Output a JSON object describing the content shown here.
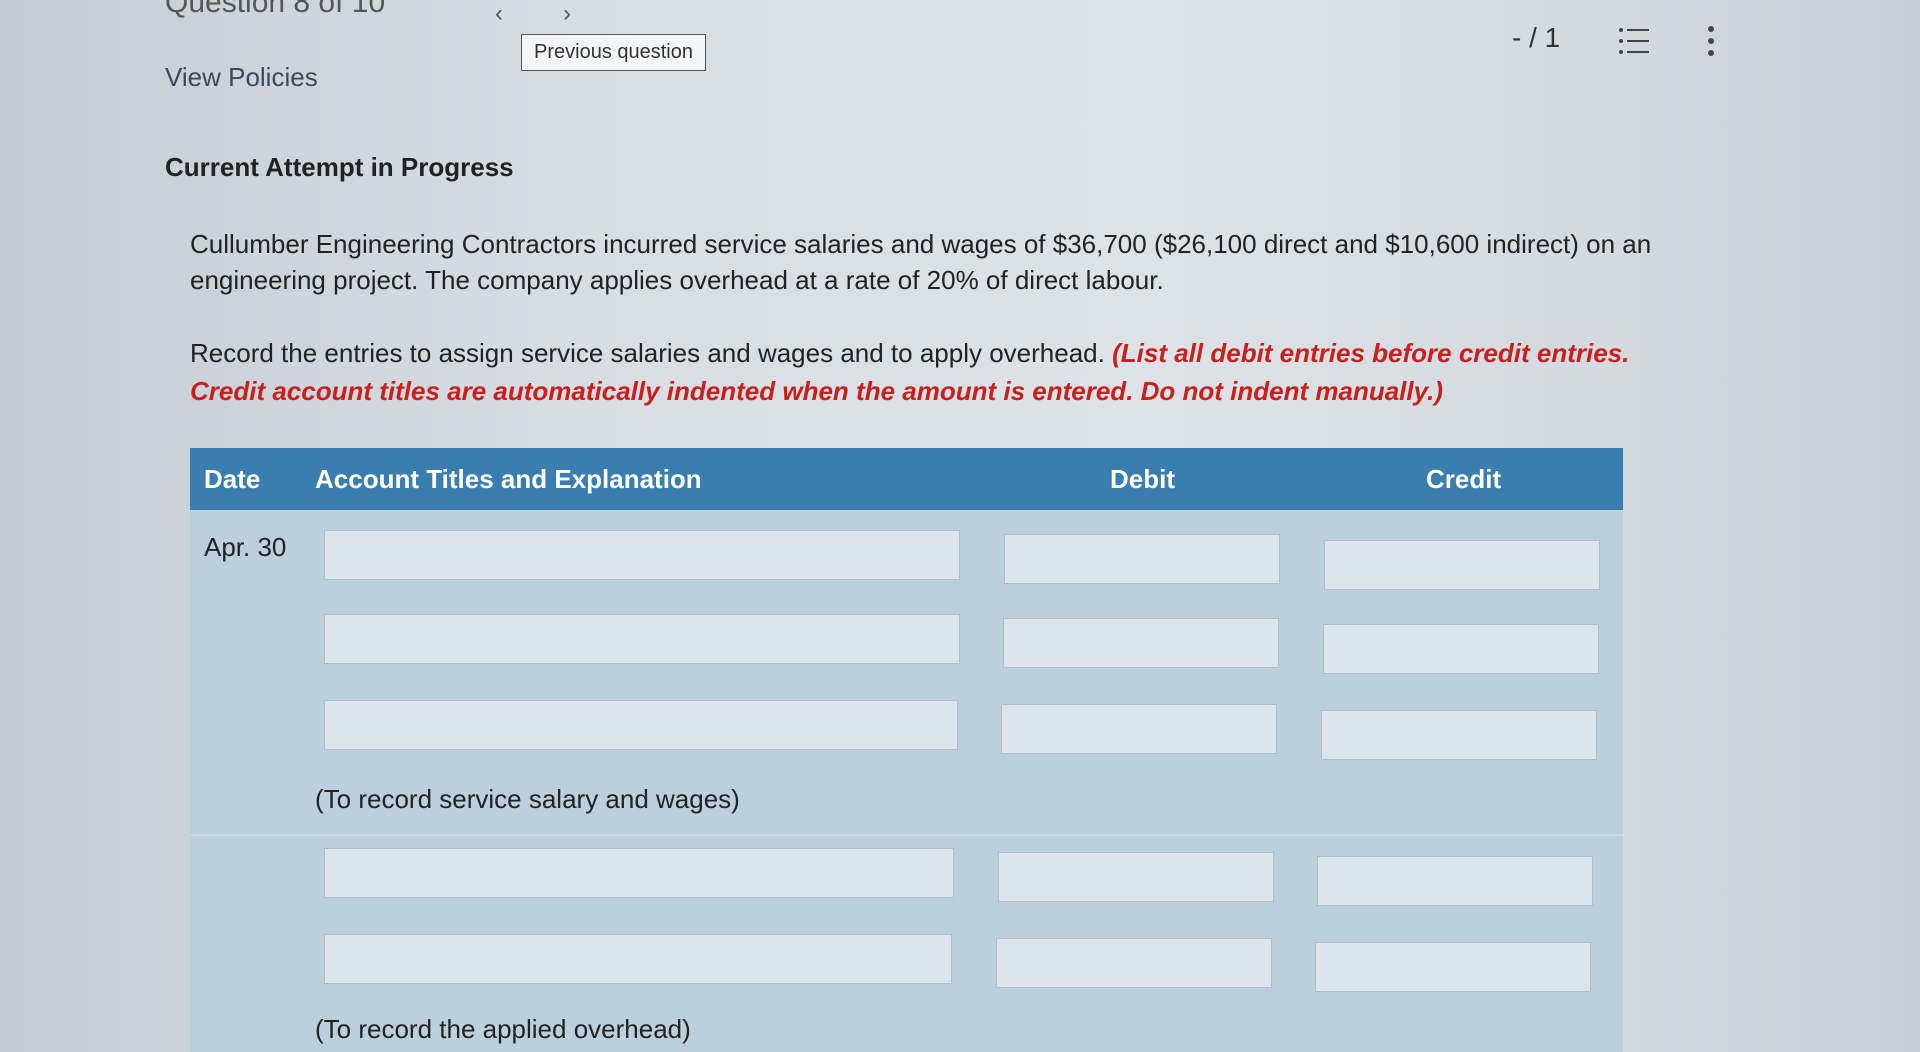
{
  "header": {
    "question_counter": "Question 8 of 10",
    "view_policies": "View Policies",
    "tooltip": "Previous question",
    "score": "- / 1",
    "prev_arrow": "‹",
    "next_arrow": "›"
  },
  "attempt_title": "Current Attempt in Progress",
  "question_text": "Cullumber Engineering Contractors incurred service salaries and wages of $36,700 ($26,100 direct and $10,600 indirect) on an engineering project. The company applies overhead at a rate of 20% of direct labour.",
  "instruction": {
    "main": "Record the entries to assign service salaries and wages and to apply overhead.",
    "note": "(List all debit entries before credit entries. Credit account titles are automatically indented when the amount is entered. Do not indent manually.)",
    "note_color": "#c8201d"
  },
  "journal": {
    "headers": {
      "date": "Date",
      "account": "Account Titles and Explanation",
      "debit": "Debit",
      "credit": "Credit"
    },
    "header_color": "#3a7eb0",
    "entries": [
      {
        "date": "Apr. 30",
        "rows": [
          {
            "account": "",
            "debit": "",
            "credit": ""
          },
          {
            "account": "",
            "debit": "",
            "credit": ""
          },
          {
            "account": "",
            "debit": "",
            "credit": ""
          }
        ],
        "explanation": "(To record service salary and wages)"
      },
      {
        "date": "",
        "rows": [
          {
            "account": "",
            "debit": "",
            "credit": ""
          },
          {
            "account": "",
            "debit": "",
            "credit": ""
          }
        ],
        "explanation": "(To record the applied overhead)"
      }
    ]
  },
  "icons": {
    "list": "list-icon",
    "more": "more-vertical-icon"
  }
}
